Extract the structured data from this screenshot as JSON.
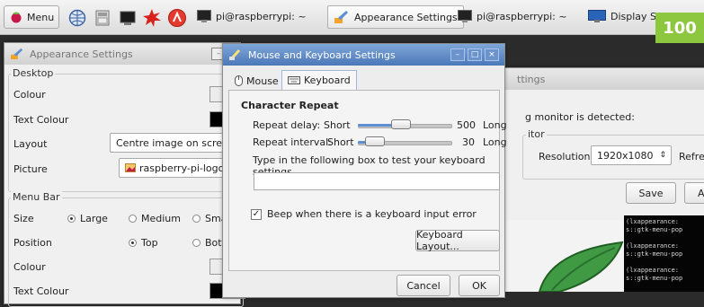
{
  "taskbar": {
    "menu_label": "Menu",
    "tasks": [
      {
        "label": "pi@raspberrypi: ~"
      },
      {
        "label": "Appearance Settings"
      },
      {
        "label": "pi@raspberrypi: ~"
      },
      {
        "label": "Display Sett"
      }
    ]
  },
  "page_number": "100",
  "appearance": {
    "title": "Appearance Settings",
    "desktop_group": "Desktop",
    "colour_label": "Colour",
    "text_colour_label": "Text Colour",
    "layout_label": "Layout",
    "layout_value": "Centre image on screen",
    "picture_label": "Picture",
    "picture_value": "raspberry-pi-logo-...",
    "menubar_group": "Menu Bar",
    "size_label": "Size",
    "size_options": [
      "Large",
      "Medium",
      "Sma"
    ],
    "position_label": "Position",
    "position_options": [
      "Top",
      "Bott"
    ],
    "menu_colour_label": "Colour",
    "menu_text_colour_label": "Text Colour"
  },
  "display": {
    "partial_title": "ttings",
    "monitor_text": "g monitor is detected:",
    "monitor_label": "itor",
    "resolution_label": "Resolution:",
    "resolution_value": "1920x1080",
    "refresh_label": "Refres",
    "save_label": "Save",
    "apply_label": "A"
  },
  "keyboard_dialog": {
    "title": "Mouse and Keyboard Settings",
    "tab_mouse": "Mouse",
    "tab_keyboard": "Keyboard",
    "section_title": "Character Repeat",
    "repeat_delay_label": "Repeat delay:",
    "repeat_delay_short": "Short",
    "repeat_delay_value": "500",
    "repeat_delay_long": "Long",
    "repeat_delay_fraction": 0.45,
    "repeat_interval_label": "Repeat interval:",
    "repeat_interval_short": "Short",
    "repeat_interval_value": "30",
    "repeat_interval_long": "Long",
    "repeat_interval_fraction": 0.1,
    "test_prompt": "Type in the following box to test your keyboard settings",
    "test_input_value": "",
    "beep_label": "Beep when there is a keyboard input error",
    "beep_checked": true,
    "layout_button": "Keyboard Layout...",
    "cancel_label": "Cancel",
    "ok_label": "OK"
  },
  "terminal": {
    "lines": [
      "(lxappearance:",
      "s::gtk-menu-pop",
      "",
      "(lxappearance:",
      "s::gtk-menu-pop",
      "",
      "(lxappearance:",
      "s::gtk-menu-pop"
    ]
  },
  "colors": {
    "accent": "#4b78b8",
    "badge": "#8dc63f",
    "leaf": "#3f9a43"
  }
}
